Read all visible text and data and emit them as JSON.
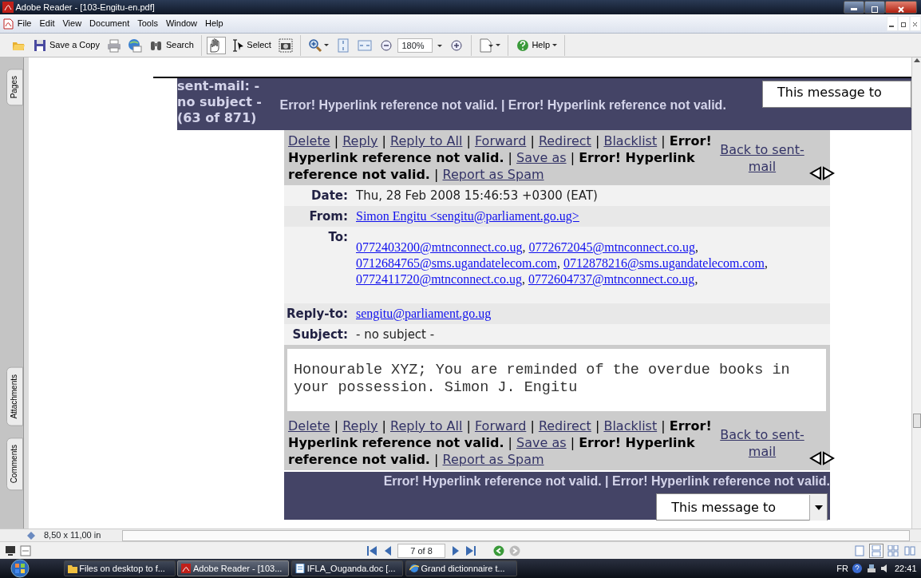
{
  "window": {
    "title": "Adobe Reader - [103-Engitu-en.pdf]"
  },
  "menu": [
    "File",
    "Edit",
    "View",
    "Document",
    "Tools",
    "Window",
    "Help"
  ],
  "toolbar": [
    [
      {
        "kind": "open"
      },
      {
        "kind": "save",
        "label": "Save a Copy"
      },
      {
        "kind": "print"
      },
      {
        "kind": "email"
      },
      {
        "kind": "search",
        "label": "Search"
      }
    ],
    [
      {
        "kind": "hand",
        "selected": true
      },
      {
        "kind": "select",
        "label": "Select",
        "selected": false
      },
      {
        "kind": "snapshot",
        "selected": false
      }
    ],
    [
      {
        "kind": "zoomtool"
      },
      {
        "kind": "fitpage"
      },
      {
        "kind": "fitwidth"
      },
      {
        "kind": "zoomout"
      },
      {
        "kind": "zoomfield",
        "value": "180%"
      },
      {
        "kind": "zoomin"
      }
    ],
    [
      {
        "kind": "pages"
      }
    ],
    [
      {
        "kind": "help",
        "label": "Help"
      }
    ]
  ],
  "sidebar_tabs": [
    "Pages",
    "Attachments",
    "Comments"
  ],
  "message": {
    "header": {
      "title": [
        "sent-mail: -",
        "no subject -",
        "(63 of 871)"
      ],
      "links_text": "Error! Hyperlink reference not valid. | Error! Hyperlink reference not valid.",
      "select": "This message to"
    },
    "actions_top": {
      "separator": "|",
      "back": "Back to sent-mail",
      "items": [
        {
          "kind": "link",
          "text": "Delete"
        },
        {
          "kind": "link",
          "text": "Reply"
        },
        {
          "kind": "link",
          "text": "Reply to All"
        },
        {
          "kind": "link",
          "text": "Forward"
        },
        {
          "kind": "link",
          "text": "Redirect"
        },
        {
          "kind": "link",
          "text": "Blacklist"
        },
        {
          "kind": "error",
          "text": "Error! Hyperlink reference not valid."
        },
        {
          "kind": "link",
          "text": "Save as"
        },
        {
          "kind": "error",
          "text": "Error! Hyperlink reference not valid."
        },
        {
          "kind": "link",
          "text": "Report as Spam"
        }
      ]
    },
    "fields": [
      {
        "label": "Date:",
        "kind": "text",
        "values": [
          "Thu, 28 Feb 2008 15:46:53 +0300 (EAT)"
        ]
      },
      {
        "label": "From:",
        "kind": "links",
        "values": [
          "Simon Engitu <sengitu@parliament.go.ug>"
        ]
      },
      {
        "label": "To:",
        "kind": "links",
        "separator": ",",
        "values": [
          "0772403200@mtnconnect.co.ug",
          "0772672045@mtnconnect.co.ug",
          "0712684765@sms.ugandatelecom.com",
          "0712878216@sms.ugandatelecom.com",
          "0772411720@mtnconnect.co.ug",
          "0772604737@mtnconnect.co.ug"
        ]
      },
      {
        "label": "Reply-to:",
        "kind": "links",
        "values": [
          "sengitu@parliament.go.ug"
        ]
      },
      {
        "label": "Subject:",
        "kind": "text",
        "values": [
          "- no subject -"
        ]
      }
    ],
    "body": "Honourable XYZ; You are reminded of the overdue books in your possession. Simon J. Engitu",
    "actions_bottom": {
      "separator": "|",
      "back": "Back to sent-mail",
      "items": [
        {
          "kind": "link",
          "text": "Delete"
        },
        {
          "kind": "link",
          "text": "Reply"
        },
        {
          "kind": "link",
          "text": "Reply to All"
        },
        {
          "kind": "link",
          "text": "Forward"
        },
        {
          "kind": "link",
          "text": "Redirect"
        },
        {
          "kind": "link",
          "text": "Blacklist"
        },
        {
          "kind": "error",
          "text": "Error! Hyperlink reference not valid."
        },
        {
          "kind": "link",
          "text": "Save as"
        },
        {
          "kind": "error",
          "text": "Error! Hyperlink reference not valid."
        },
        {
          "kind": "link",
          "text": "Report as Spam"
        }
      ]
    },
    "footer": {
      "links_text": "Error! Hyperlink reference not valid. | Error! Hyperlink reference not valid.",
      "select": "This message to"
    }
  },
  "status_bar": {
    "page_size": "8,50 x 11,00 in"
  },
  "navigation": {
    "page": "7 of 8"
  },
  "view_modes": [
    {
      "selected": false
    },
    {
      "selected": true
    },
    {
      "selected": false
    },
    {
      "selected": false
    }
  ],
  "taskbar": {
    "items": [
      {
        "kind": "folder",
        "label": "Files on desktop to f...",
        "selected": false
      },
      {
        "kind": "reader",
        "label": "Adobe Reader - [103...",
        "selected": true
      },
      {
        "kind": "document",
        "label": "IFLA_Ouganda.doc [...",
        "selected": false
      },
      {
        "kind": "browser",
        "label": "Grand dictionnaire t...",
        "selected": false
      }
    ],
    "language": "FR",
    "clock": "22:41"
  }
}
